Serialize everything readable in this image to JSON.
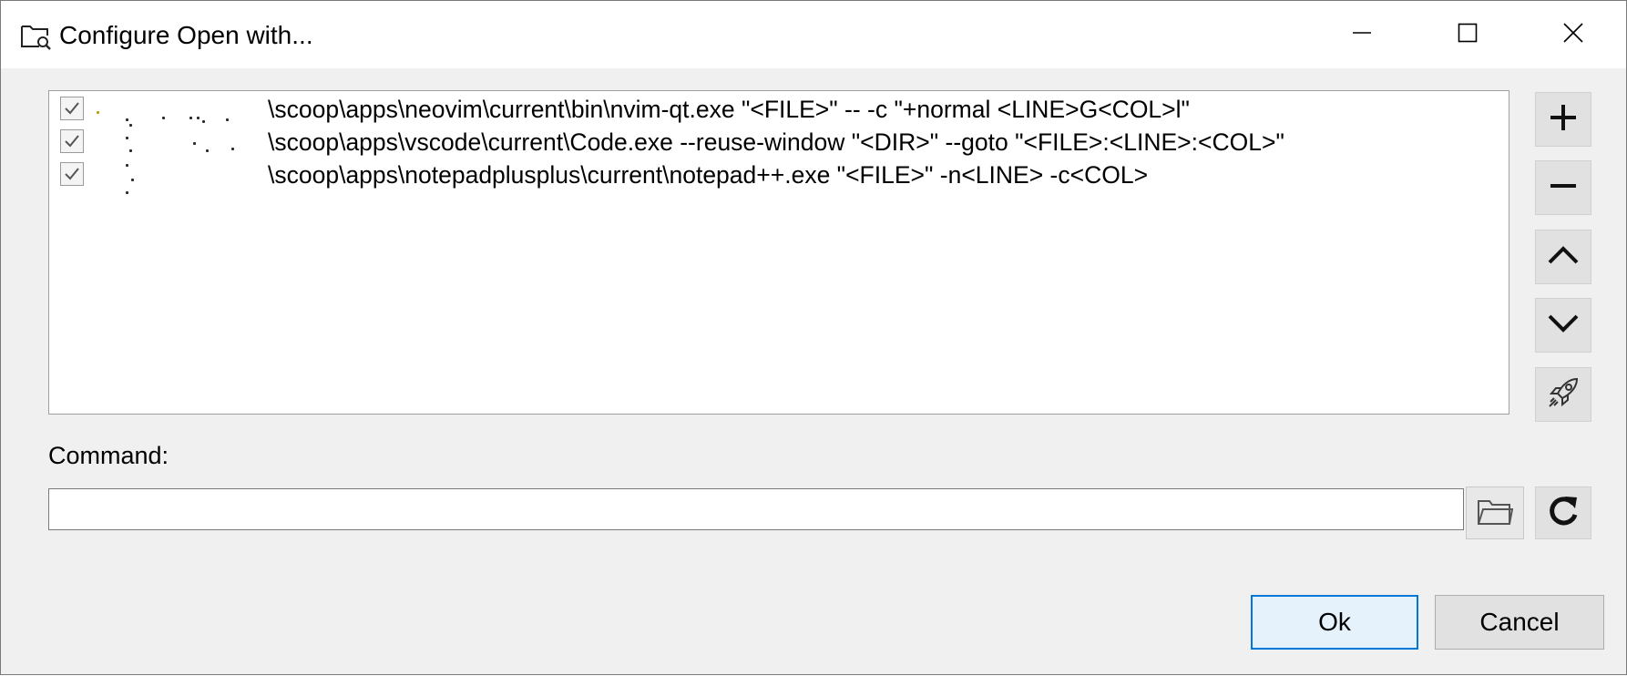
{
  "window": {
    "title": "Configure Open with..."
  },
  "icons": {
    "app": "folder-search-icon",
    "minimize": "minimize-icon",
    "maximize": "maximize-icon",
    "close": "close-icon",
    "add": "plus-icon",
    "remove": "minus-icon",
    "up": "chevron-up-icon",
    "down": "chevron-down-icon",
    "launch": "rocket-icon",
    "browse": "folder-icon",
    "reset": "refresh-icon"
  },
  "editors": [
    {
      "checked": true,
      "command": "\\scoop\\apps\\neovim\\current\\bin\\nvim-qt.exe \"<FILE>\" -- -c \"+normal <LINE>G<COL>l\""
    },
    {
      "checked": true,
      "command": "\\scoop\\apps\\vscode\\current\\Code.exe --reuse-window \"<DIR>\" --goto \"<FILE>:<LINE>:<COL>\""
    },
    {
      "checked": true,
      "command": "\\scoop\\apps\\notepadplusplus\\current\\notepad++.exe \"<FILE>\" -n<LINE> -c<COL>"
    }
  ],
  "command_field": {
    "label": "Command:",
    "value": ""
  },
  "buttons": {
    "ok": "Ok",
    "cancel": "Cancel"
  },
  "colors": {
    "accent": "#0078d7",
    "button_face": "#e1e1e1",
    "dialog_bg": "#f0f0f0"
  }
}
